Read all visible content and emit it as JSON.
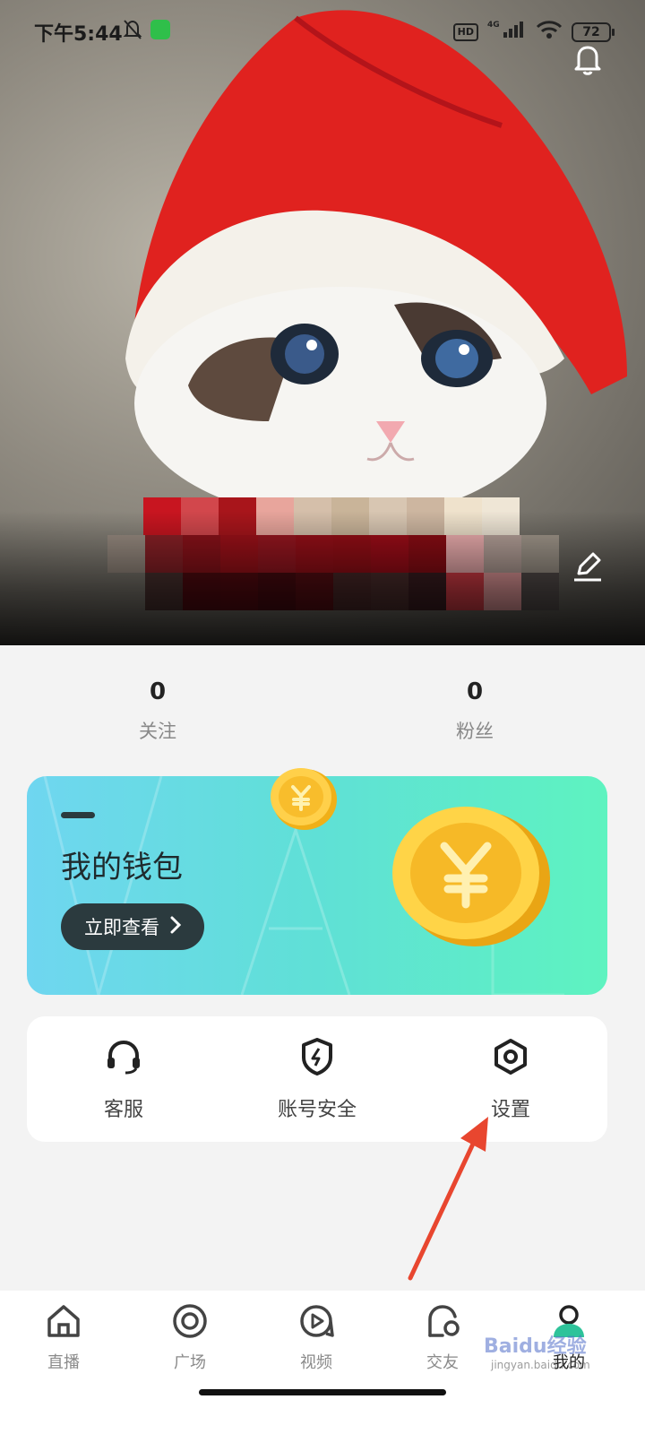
{
  "status_bar": {
    "time": "下午5:44",
    "battery": "72",
    "hd_badge": "HD",
    "network": "4G"
  },
  "profile": {
    "stats": [
      {
        "value": "0",
        "label": "关注"
      },
      {
        "value": "0",
        "label": "粉丝"
      }
    ]
  },
  "wallet": {
    "title": "我的钱包",
    "button_label": "立即查看"
  },
  "quick_menu": [
    {
      "label": "客服",
      "icon": "headset-icon"
    },
    {
      "label": "账号安全",
      "icon": "shield-icon"
    },
    {
      "label": "设置",
      "icon": "gear-icon"
    }
  ],
  "bottom_nav": [
    {
      "label": "直播",
      "icon": "home-icon"
    },
    {
      "label": "广场",
      "icon": "target-icon"
    },
    {
      "label": "视频",
      "icon": "video-icon"
    },
    {
      "label": "交友",
      "icon": "friends-icon"
    },
    {
      "label": "我的",
      "icon": "user-icon",
      "active": true
    }
  ],
  "watermark": {
    "text": "Baidu经验",
    "sub": "jingyan.baidu.com"
  },
  "colors": {
    "accent": "#2ec39a",
    "wallet_start": "#6fd6f0",
    "wallet_end": "#5ef3c0",
    "annotation_arrow": "#e8462f"
  }
}
